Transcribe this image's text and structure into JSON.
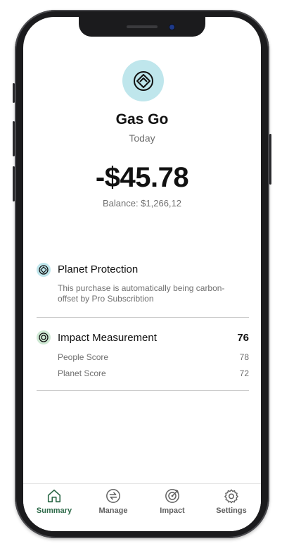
{
  "transaction": {
    "merchant": "Gas Go",
    "date": "Today",
    "amount": "-$45.78",
    "balance": "Balance: $1,266,12"
  },
  "planet_protection": {
    "title": "Planet Protection",
    "description": "This purchase is automatically being carbon-offset by Pro Subscribtion"
  },
  "impact": {
    "title": "Impact Measurement",
    "total": "76",
    "rows": [
      {
        "label": "People Score",
        "value": "78"
      },
      {
        "label": "Planet Score",
        "value": "72"
      }
    ]
  },
  "tabs": [
    {
      "label": "Summary",
      "icon": "home-icon",
      "active": true
    },
    {
      "label": "Manage",
      "icon": "transfer-icon",
      "active": false
    },
    {
      "label": "Impact",
      "icon": "target-icon",
      "active": false
    },
    {
      "label": "Settings",
      "icon": "gear-icon",
      "active": false
    }
  ],
  "colors": {
    "accent": "#2f6b4a",
    "logo_bg": "#bfe6ec",
    "planet_icon_bg": "#bfe6ec",
    "impact_icon_bg": "#cfe9d4"
  }
}
